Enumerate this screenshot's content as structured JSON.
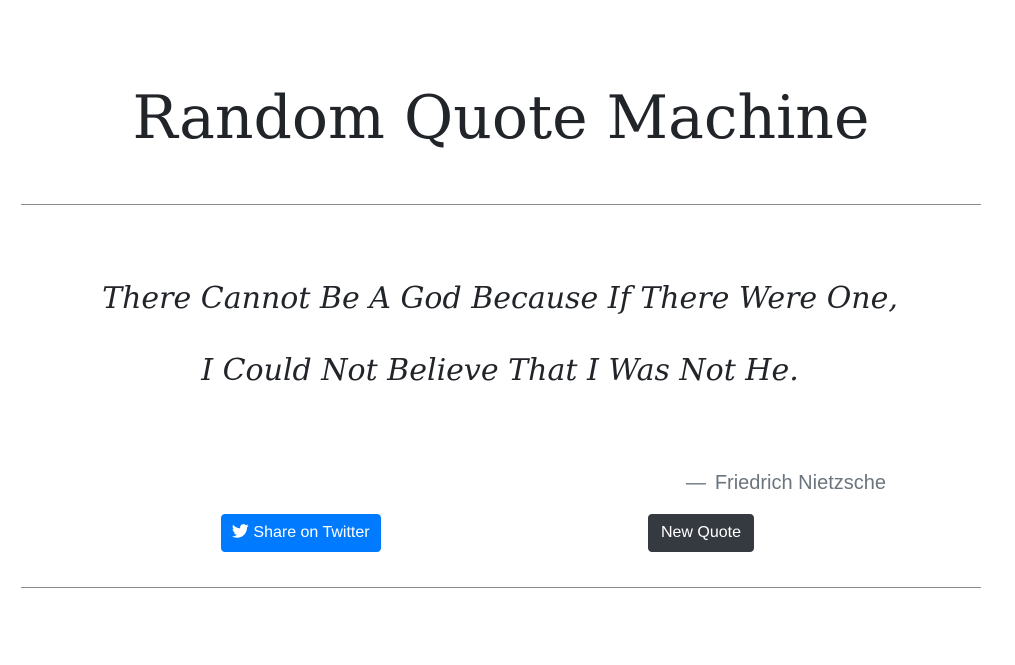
{
  "header": {
    "title": "Random Quote Machine"
  },
  "quote": {
    "line1": "There Cannot Be A God Because If There Were One,",
    "line2": "I Could Not Believe That I Was Not He.",
    "author_dash": "—",
    "author": "Friedrich Nietzsche"
  },
  "actions": {
    "share_label": "Share on Twitter",
    "share_icon": "twitter-icon",
    "new_quote_label": "New Quote"
  },
  "colors": {
    "primary": "#007bff",
    "dark": "#343a40",
    "muted": "#6c757d",
    "text": "#212529"
  }
}
